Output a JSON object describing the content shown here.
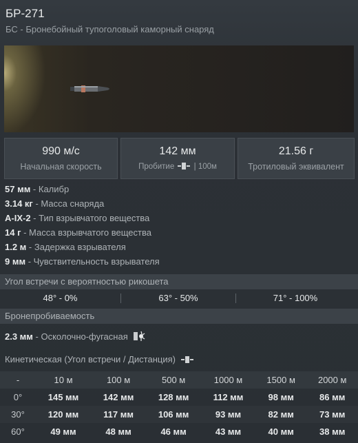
{
  "header": {
    "title": "БР-271",
    "subtitle": "БС - Бронебойный тупоголовый каморный снаряд"
  },
  "stats": [
    {
      "value": "990 м/с",
      "label": "Начальная скорость"
    },
    {
      "value": "142 мм",
      "label_prefix": "Пробитие",
      "label_suffix": "| 100м"
    },
    {
      "value": "21.56 г",
      "label": "Тротиловый эквивалент"
    }
  ],
  "properties": [
    {
      "value": "57 мм",
      "label": " - Калибр"
    },
    {
      "value": "3.14 кг",
      "label": " - Масса снаряда"
    },
    {
      "value": "A-IX-2",
      "label": " - Тип взрывчатого вещества"
    },
    {
      "value": "14 г",
      "label": " - Масса взрывчатого вещества"
    },
    {
      "value": "1.2 м",
      "label": " - Задержка взрывателя"
    },
    {
      "value": "9 мм",
      "label": " - Чувствительность взрывателя"
    }
  ],
  "ricochet": {
    "title": "Угол встречи с вероятностью рикошета",
    "values": [
      "48° - 0%",
      "63° - 50%",
      "71° - 100%"
    ]
  },
  "penetration": {
    "title": "Бронепробиваемость",
    "he_value": "2.3 мм",
    "he_label": " - Осколочно-фугасная",
    "kinetic_title": "Кинетическая (Угол встречи / Дистанция)"
  },
  "pen_table": {
    "headers": [
      "-",
      "10 м",
      "100 м",
      "500 м",
      "1000 м",
      "1500 м",
      "2000 м"
    ],
    "rows": [
      [
        "0°",
        "145 мм",
        "142 мм",
        "128 мм",
        "112 мм",
        "98 мм",
        "86 мм"
      ],
      [
        "30°",
        "120 мм",
        "117 мм",
        "106 мм",
        "93 мм",
        "82 мм",
        "73 мм"
      ],
      [
        "60°",
        "49 мм",
        "48 мм",
        "46 мм",
        "43 мм",
        "40 мм",
        "38 мм"
      ]
    ]
  },
  "colors": {
    "background": "#2b3035",
    "text_primary": "#e7e9ea",
    "text_secondary": "#aeb3b7",
    "section_bar": "#3c4248"
  }
}
